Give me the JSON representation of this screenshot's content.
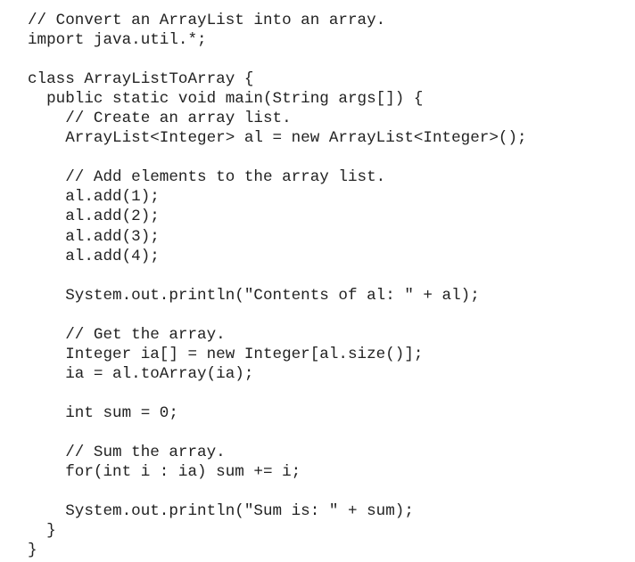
{
  "code": {
    "lines": [
      "// Convert an ArrayList into an array.",
      "import java.util.*;",
      "",
      "class ArrayListToArray {",
      "  public static void main(String args[]) {",
      "    // Create an array list.",
      "    ArrayList<Integer> al = new ArrayList<Integer>();",
      "",
      "    // Add elements to the array list.",
      "    al.add(1);",
      "    al.add(2);",
      "    al.add(3);",
      "    al.add(4);",
      "",
      "    System.out.println(\"Contents of al: \" + al);",
      "",
      "    // Get the array.",
      "    Integer ia[] = new Integer[al.size()];",
      "    ia = al.toArray(ia);",
      "",
      "    int sum = 0;",
      "",
      "    // Sum the array.",
      "    for(int i : ia) sum += i;",
      "",
      "    System.out.println(\"Sum is: \" + sum);",
      "  }",
      "}"
    ]
  }
}
